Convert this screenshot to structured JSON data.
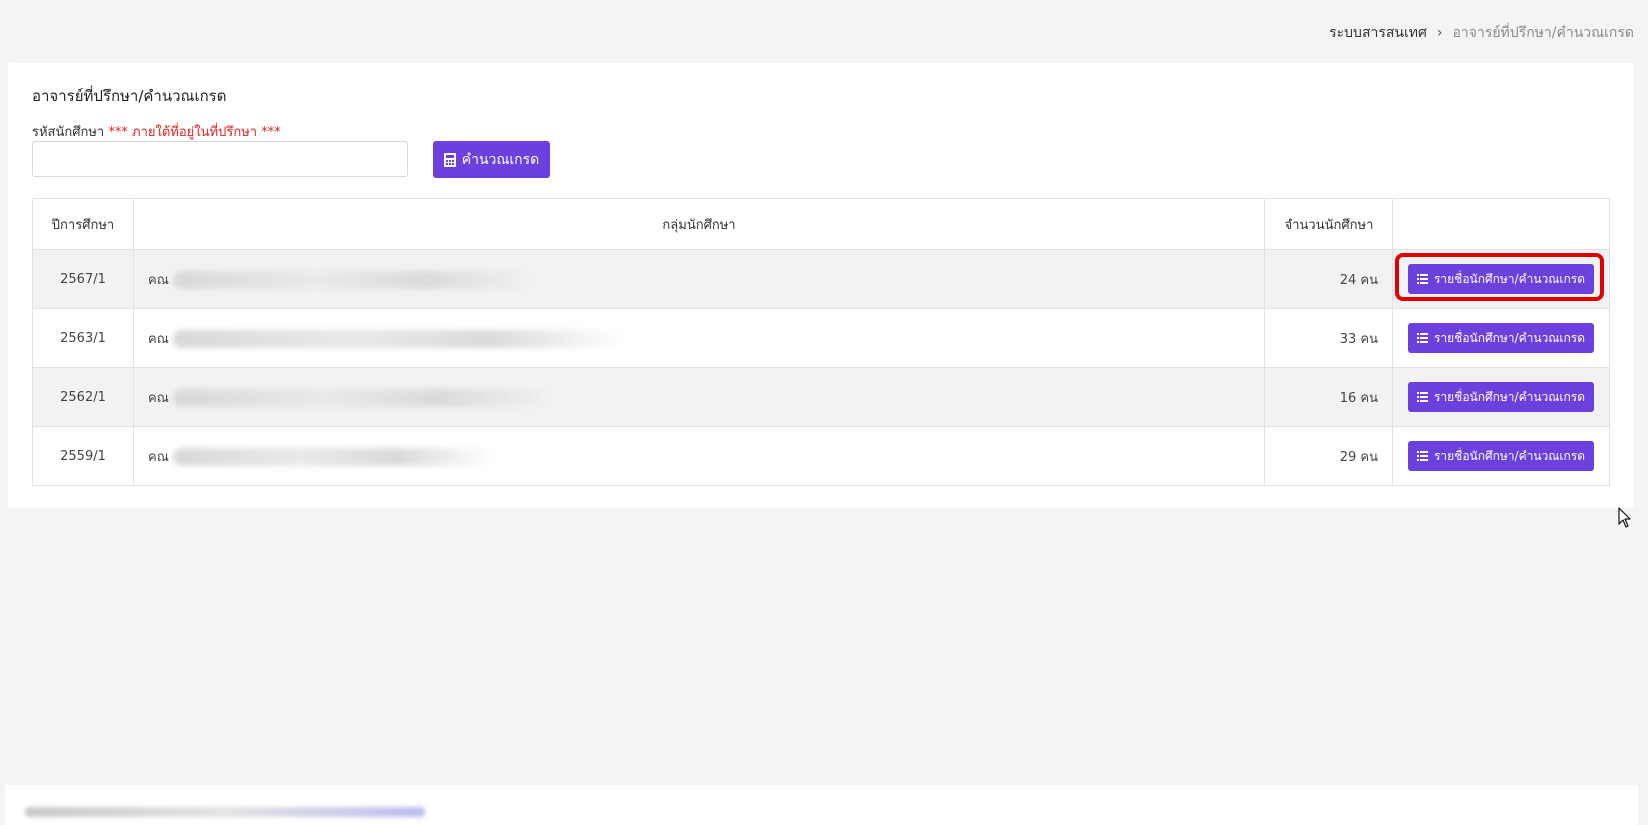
{
  "breadcrumb": {
    "root": "ระบบสารสนเทศ",
    "separator": "›",
    "current": "อาจารย์ที่ปรึกษา/คำนวณเกรด"
  },
  "card": {
    "title": "อาจารย์ที่ปรึกษา/คำนวณเกรด",
    "field_label": "รหัสนักศึกษา",
    "field_warning": "*** ภายใต้ที่อยู่ในที่ปรึกษา ***",
    "input_value": "",
    "calc_button": "คำนวณเกรด",
    "calc_icon": "calculator-icon"
  },
  "table": {
    "headers": [
      "ปีการศึกษา",
      "กลุ่มนักศึกษา",
      "จำนวนนักศึกษา",
      ""
    ],
    "rows": [
      {
        "year": "2567/1",
        "group": "คณ",
        "count": "24 คน",
        "action": "รายชื่อนักศึกษา/คำนวณเกรด"
      },
      {
        "year": "2563/1",
        "group": "คณ",
        "count": "33 คน",
        "action": "รายชื่อนักศึกษา/คำนวณเกรด"
      },
      {
        "year": "2562/1",
        "group": "คณ",
        "count": "16 คน",
        "action": "รายชื่อนักศึกษา/คำนวณเกรด"
      },
      {
        "year": "2559/1",
        "group": "คณ",
        "count": "29 คน",
        "action": "รายชื่อนักศึกษา/คำนวณเกรด"
      }
    ],
    "action_icon": "list-icon"
  },
  "colors": {
    "accent": "#6b40dc",
    "warning": "#e02424",
    "highlight": "#e00000"
  }
}
